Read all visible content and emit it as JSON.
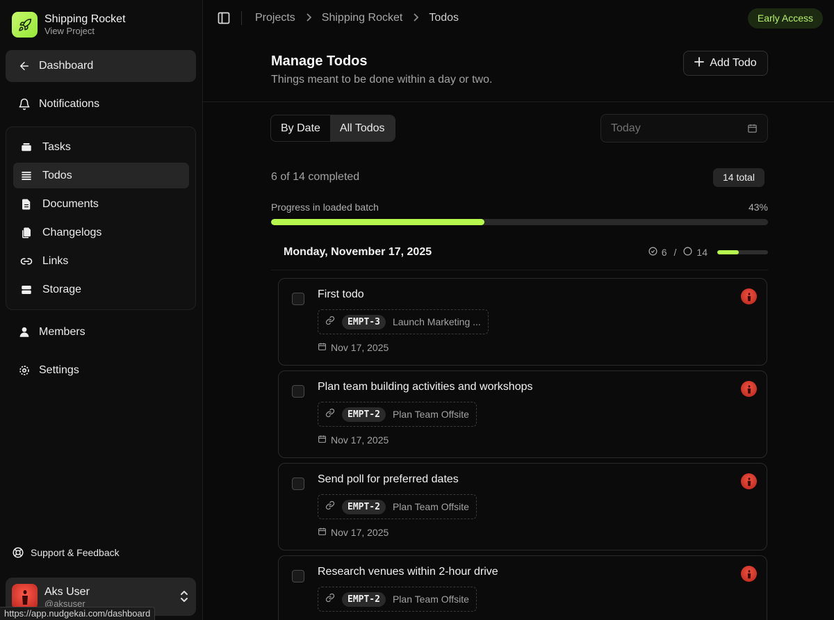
{
  "project": {
    "name": "Shipping Rocket",
    "subtitle": "View Project"
  },
  "sidebar": {
    "dashboard": "Dashboard",
    "notifications": "Notifications",
    "items": [
      {
        "label": "Tasks",
        "icon": "tasks-icon"
      },
      {
        "label": "Todos",
        "icon": "todos-icon",
        "active": true
      },
      {
        "label": "Documents",
        "icon": "document-icon"
      },
      {
        "label": "Changelogs",
        "icon": "changelog-icon"
      },
      {
        "label": "Links",
        "icon": "link-icon"
      },
      {
        "label": "Storage",
        "icon": "storage-icon"
      }
    ],
    "members": "Members",
    "settings": "Settings",
    "support": "Support & Feedback"
  },
  "user": {
    "name": "Aks User",
    "handle": "@aksuser"
  },
  "status_url": "https://app.nudgekai.com/dashboard",
  "breadcrumbs": [
    "Projects",
    "Shipping Rocket",
    "Todos"
  ],
  "badge_early": "Early Access",
  "page": {
    "title": "Manage Todos",
    "subtitle": "Things meant to be done within a day or two.",
    "add_button": "Add Todo"
  },
  "view_toggle": {
    "by_date": "By Date",
    "all_todos": "All Todos",
    "selected": "All Todos"
  },
  "date_filter": {
    "placeholder": "Today"
  },
  "summary": {
    "completed_text": "6 of 14 completed",
    "total_badge": "14 total",
    "progress_label": "Progress in loaded batch",
    "progress_pct_text": "43%",
    "progress_fraction": 0.43
  },
  "group": {
    "date": "Monday, November 17, 2025",
    "done": "6",
    "sep": "/",
    "total": "14",
    "fraction": 0.43
  },
  "todos": [
    {
      "title": "First todo",
      "ticket": "EMPT-3",
      "ticket_title": "Launch Marketing ...",
      "date": "Nov 17, 2025"
    },
    {
      "title": "Plan team building activities and workshops",
      "ticket": "EMPT-2",
      "ticket_title": "Plan Team Offsite",
      "date": "Nov 17, 2025"
    },
    {
      "title": "Send poll for preferred dates",
      "ticket": "EMPT-2",
      "ticket_title": "Plan Team Offsite",
      "date": "Nov 17, 2025"
    },
    {
      "title": "Research venues within 2-hour drive",
      "ticket": "EMPT-2",
      "ticket_title": "Plan Team Offsite",
      "date": ""
    }
  ],
  "colors": {
    "accent": "#b6f84e",
    "avatar": "#d6362a",
    "bg": "#0a0a0a"
  }
}
